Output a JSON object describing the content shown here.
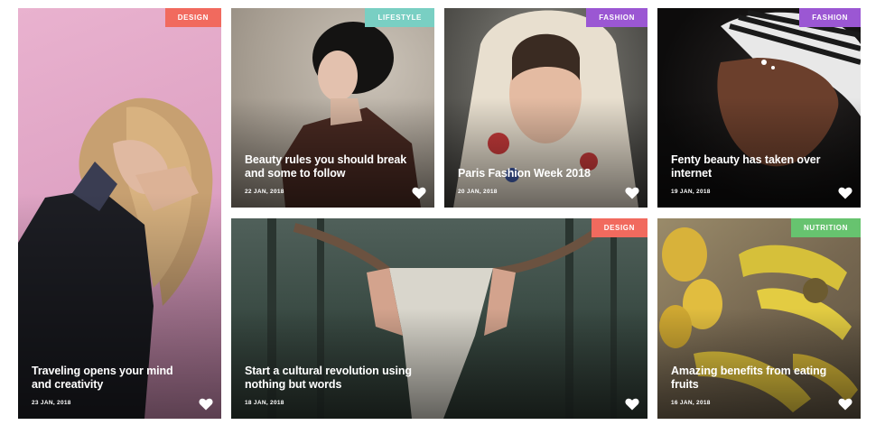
{
  "colors": {
    "design": "#f16a5e",
    "lifestyle": "#79cfc3",
    "fashion": "#9b57d3",
    "nutrition": "#67c36f"
  },
  "cards": [
    {
      "category": "DESIGN",
      "title": "Traveling opens your mind and creativity",
      "date": "23 JAN, 2018"
    },
    {
      "category": "LIFESTYLE",
      "title": "Beauty rules you should break and some to follow",
      "date": "22 JAN, 2018"
    },
    {
      "category": "FASHION",
      "title": "Paris Fashion Week 2018",
      "date": "20 JAN, 2018"
    },
    {
      "category": "FASHION",
      "title": "Fenty beauty has taken over internet",
      "date": "19 JAN, 2018"
    },
    {
      "category": "DESIGN",
      "title": "Start a cultural revolution using nothing but words",
      "date": "18 JAN, 2018"
    },
    {
      "category": "NUTRITION",
      "title": "Amazing benefits from eating fruits",
      "date": "16 JAN, 2018"
    }
  ]
}
